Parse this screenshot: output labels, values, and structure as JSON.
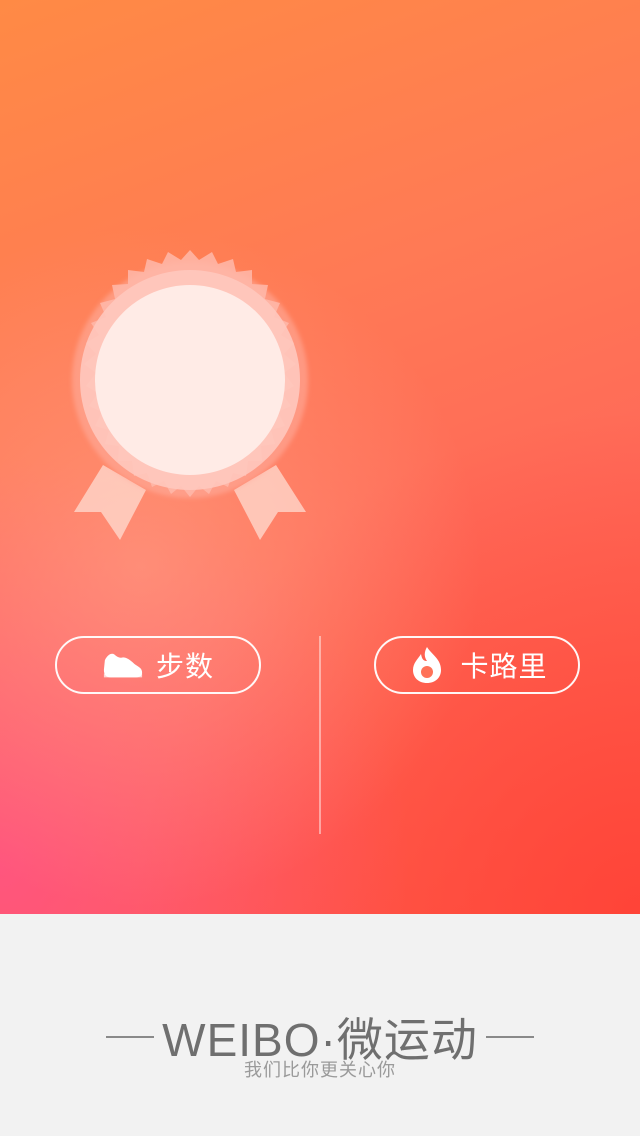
{
  "hero": {
    "steps_button": {
      "label": "步数",
      "icon": "sneaker-icon"
    },
    "calories_button": {
      "label": "卡路里",
      "icon": "flame-icon"
    },
    "badge": {
      "icon": "medal-badge-icon"
    }
  },
  "footer": {
    "brand": "WEIBO·微运动",
    "slogan": "我们比你更关心你"
  },
  "colors": {
    "gradient_top": "#ff8a45",
    "gradient_bottom": "#ff5b49",
    "footer_bg": "#f2f2f2",
    "brand_text": "#6f6f6f"
  }
}
